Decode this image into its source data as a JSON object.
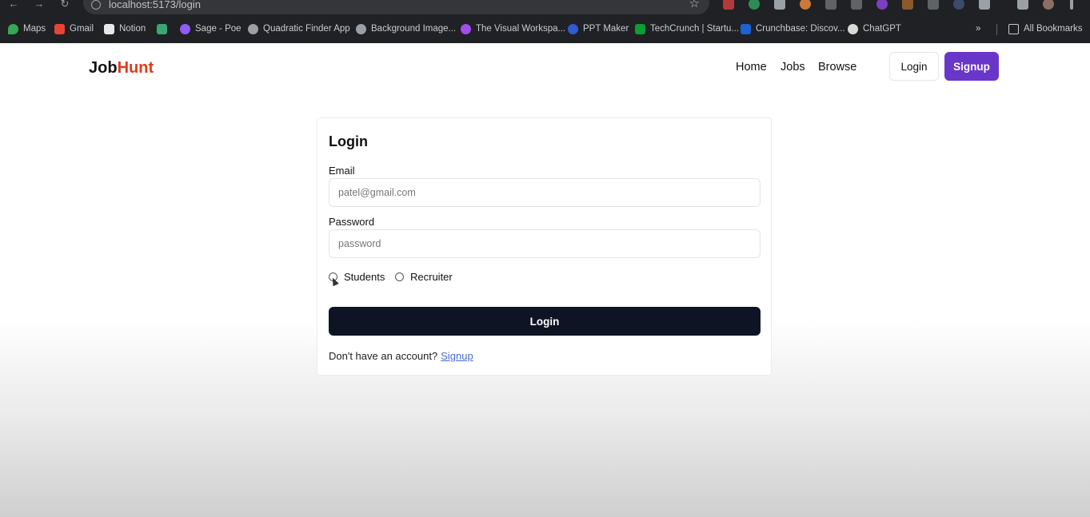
{
  "browser": {
    "url": "localhost:5173/login",
    "bookmarks": [
      "Maps",
      "Gmail",
      "Notion",
      "",
      "Sage - Poe",
      "Quadratic Finder App",
      "Background Image...",
      "The Visual Workspa...",
      "PPT Maker",
      "TechCrunch | Startu...",
      "Crunchbase: Discov...",
      "ChatGPT"
    ],
    "all_bookmarks_label": "All Bookmarks"
  },
  "header": {
    "logo_part1": "Job",
    "logo_part2": "Hunt",
    "nav": [
      "Home",
      "Jobs",
      "Browse"
    ],
    "login_label": "Login",
    "signup_label": "Signup"
  },
  "form": {
    "title": "Login",
    "email_label": "Email",
    "email_placeholder": "patel@gmail.com",
    "password_label": "Password",
    "password_placeholder": "password",
    "roles": [
      "Students",
      "Recruiter"
    ],
    "submit_label": "Login",
    "footer_text": "Don't have an account?",
    "footer_link": "Signup"
  },
  "colors": {
    "accent": "#e03b1a",
    "signup_button": "#6a36c9",
    "submit_button": "#0f1424",
    "link": "#4a6bd6"
  }
}
